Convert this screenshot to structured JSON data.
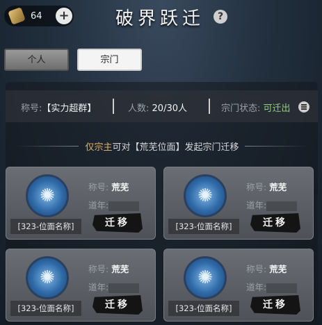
{
  "header": {
    "currency_amount": "64",
    "title": "破界跃迁"
  },
  "tabs": [
    {
      "label": "个人",
      "selected": false
    },
    {
      "label": "宗门",
      "selected": true
    }
  ],
  "info": {
    "title_label": "称号:",
    "title_value": "【实力超群】",
    "count_label": "人数:",
    "count_value": "20/30人",
    "status_label": "宗门状态:",
    "status_value": "可迁出"
  },
  "notice": {
    "highlight": "仅宗主",
    "text": "可对【荒芜位面】发起宗门迁移"
  },
  "cards": [
    {
      "title_label": "称号:",
      "title_value": "荒芜",
      "year_label": "道年:",
      "plane_name": "[323-位面名称]",
      "button": "迁移"
    },
    {
      "title_label": "称号:",
      "title_value": "荒芜",
      "year_label": "道年:",
      "plane_name": "[323-位面名称]",
      "button": "迁移"
    },
    {
      "title_label": "称号:",
      "title_value": "荒芜",
      "year_label": "道年:",
      "plane_name": "[323-位面名称]",
      "button": "迁移"
    },
    {
      "title_label": "称号:",
      "title_value": "荒芜",
      "year_label": "道年:",
      "plane_name": "[323-位面名称]",
      "button": "迁移"
    }
  ],
  "colors": {
    "status_green": "#8ed07a",
    "highlight_gold": "#e0b062"
  }
}
